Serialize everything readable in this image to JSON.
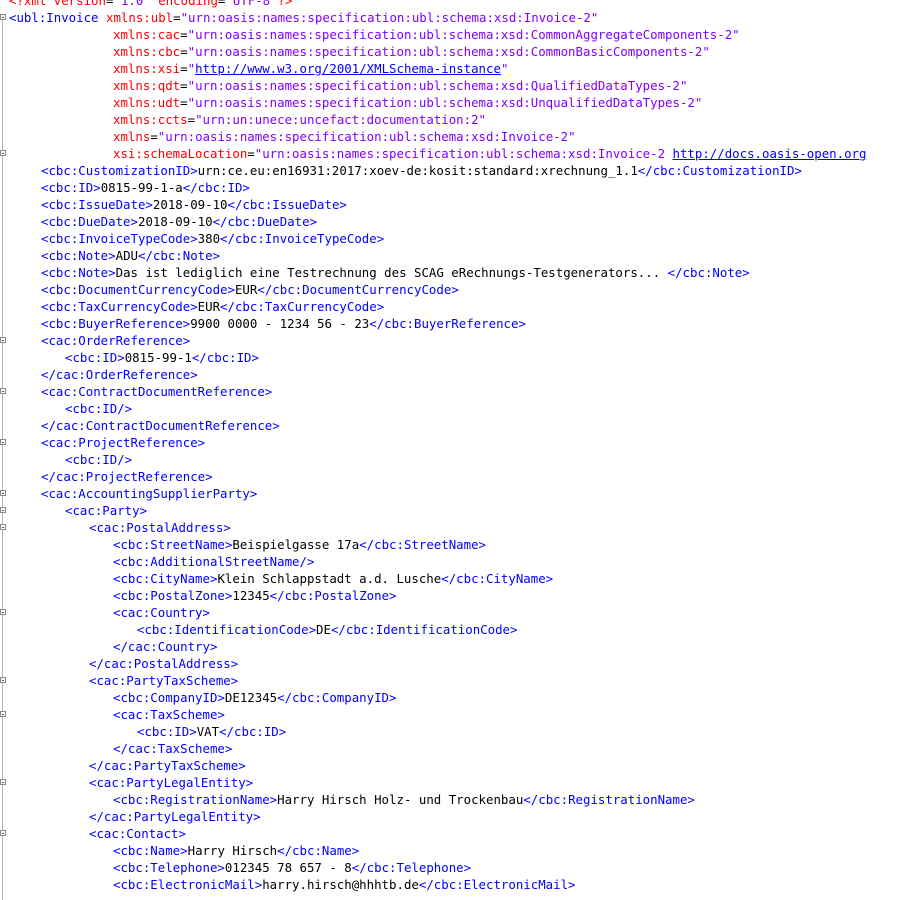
{
  "editor": {
    "colors": {
      "tag": "#0000ff",
      "attribute": "#ff0000",
      "value": "#8000ff",
      "text": "#000000"
    },
    "lines": [
      {
        "indent": 0,
        "tokens": [
          {
            "t": "pi",
            "v": "<?"
          },
          {
            "t": "attr",
            "v": "xml version"
          },
          {
            "t": "txt",
            "v": "="
          },
          {
            "t": "val",
            "v": "\"1.0\""
          },
          {
            "t": "attr",
            "v": " encoding"
          },
          {
            "t": "txt",
            "v": "="
          },
          {
            "t": "val",
            "v": "\"UTF-8\""
          },
          {
            "t": "pi",
            "v": "?>"
          }
        ]
      },
      {
        "indent": 0,
        "tokens": [
          {
            "t": "tag",
            "v": "<ubl:Invoice "
          },
          {
            "t": "attr",
            "v": "xmlns:ubl"
          },
          {
            "t": "txt",
            "v": "="
          },
          {
            "t": "val",
            "v": "\"urn:oasis:names:specification:ubl:schema:xsd:Invoice-2\""
          }
        ]
      },
      {
        "indent": 13,
        "tokens": [
          {
            "t": "attr",
            "v": "xmlns:cac"
          },
          {
            "t": "txt",
            "v": "="
          },
          {
            "t": "val",
            "v": "\"urn:oasis:names:specification:ubl:schema:xsd:CommonAggregateComponents-2\""
          }
        ]
      },
      {
        "indent": 13,
        "tokens": [
          {
            "t": "attr",
            "v": "xmlns:cbc"
          },
          {
            "t": "txt",
            "v": "="
          },
          {
            "t": "val",
            "v": "\"urn:oasis:names:specification:ubl:schema:xsd:CommonBasicComponents-2\""
          }
        ]
      },
      {
        "indent": 13,
        "tokens": [
          {
            "t": "attr",
            "v": "xmlns:xsi"
          },
          {
            "t": "txt",
            "v": "="
          },
          {
            "t": "val",
            "v": "\""
          },
          {
            "t": "link",
            "v": "http://www.w3.org/2001/XMLSchema-instance"
          },
          {
            "t": "val",
            "v": "\""
          }
        ]
      },
      {
        "indent": 13,
        "tokens": [
          {
            "t": "attr",
            "v": "xmlns:qdt"
          },
          {
            "t": "txt",
            "v": "="
          },
          {
            "t": "val",
            "v": "\"urn:oasis:names:specification:ubl:schema:xsd:QualifiedDataTypes-2\""
          }
        ]
      },
      {
        "indent": 13,
        "tokens": [
          {
            "t": "attr",
            "v": "xmlns:udt"
          },
          {
            "t": "txt",
            "v": "="
          },
          {
            "t": "val",
            "v": "\"urn:oasis:names:specification:ubl:schema:xsd:UnqualifiedDataTypes-2\""
          }
        ]
      },
      {
        "indent": 13,
        "tokens": [
          {
            "t": "attr",
            "v": "xmlns:ccts"
          },
          {
            "t": "txt",
            "v": "="
          },
          {
            "t": "val",
            "v": "\"urn:un:unece:uncefact:documentation:2\""
          }
        ]
      },
      {
        "indent": 13,
        "tokens": [
          {
            "t": "attr",
            "v": "xmlns"
          },
          {
            "t": "txt",
            "v": "="
          },
          {
            "t": "val",
            "v": "\"urn:oasis:names:specification:ubl:schema:xsd:Invoice-2\""
          }
        ]
      },
      {
        "indent": 13,
        "tokens": [
          {
            "t": "attr",
            "v": "xsi:schemaLocation"
          },
          {
            "t": "txt",
            "v": "="
          },
          {
            "t": "val",
            "v": "\"urn:oasis:names:specification:ubl:schema:xsd:Invoice-2 "
          },
          {
            "t": "link",
            "v": "http://docs.oasis-open.org"
          }
        ]
      },
      {
        "indent": 4,
        "tokens": [
          {
            "t": "tag",
            "v": "<cbc:CustomizationID>"
          },
          {
            "t": "txt",
            "v": "urn:ce.eu:en16931:2017:xoev-de:kosit:standard:xrechnung_1.1"
          },
          {
            "t": "tag",
            "v": "</cbc:CustomizationID>"
          }
        ]
      },
      {
        "indent": 4,
        "tokens": [
          {
            "t": "tag",
            "v": "<cbc:ID>"
          },
          {
            "t": "txt",
            "v": "0815-99-1-a"
          },
          {
            "t": "tag",
            "v": "</cbc:ID>"
          }
        ]
      },
      {
        "indent": 4,
        "tokens": [
          {
            "t": "tag",
            "v": "<cbc:IssueDate>"
          },
          {
            "t": "txt",
            "v": "2018-09-10"
          },
          {
            "t": "tag",
            "v": "</cbc:IssueDate>"
          }
        ]
      },
      {
        "indent": 4,
        "tokens": [
          {
            "t": "tag",
            "v": "<cbc:DueDate>"
          },
          {
            "t": "txt",
            "v": "2018-09-10"
          },
          {
            "t": "tag",
            "v": "</cbc:DueDate>"
          }
        ]
      },
      {
        "indent": 4,
        "tokens": [
          {
            "t": "tag",
            "v": "<cbc:InvoiceTypeCode>"
          },
          {
            "t": "txt",
            "v": "380"
          },
          {
            "t": "tag",
            "v": "</cbc:InvoiceTypeCode>"
          }
        ]
      },
      {
        "indent": 4,
        "tokens": [
          {
            "t": "tag",
            "v": "<cbc:Note>"
          },
          {
            "t": "txt",
            "v": "ADU"
          },
          {
            "t": "tag",
            "v": "</cbc:Note>"
          }
        ]
      },
      {
        "indent": 4,
        "tokens": [
          {
            "t": "tag",
            "v": "<cbc:Note>"
          },
          {
            "t": "txt",
            "v": "Das ist lediglich eine Testrechnung des SCAG eRechnungs-Testgenerators... "
          },
          {
            "t": "tag",
            "v": "</cbc:Note>"
          }
        ]
      },
      {
        "indent": 4,
        "tokens": [
          {
            "t": "tag",
            "v": "<cbc:DocumentCurrencyCode>"
          },
          {
            "t": "txt",
            "v": "EUR"
          },
          {
            "t": "tag",
            "v": "</cbc:DocumentCurrencyCode>"
          }
        ]
      },
      {
        "indent": 4,
        "tokens": [
          {
            "t": "tag",
            "v": "<cbc:TaxCurrencyCode>"
          },
          {
            "t": "txt",
            "v": "EUR"
          },
          {
            "t": "tag",
            "v": "</cbc:TaxCurrencyCode>"
          }
        ]
      },
      {
        "indent": 4,
        "tokens": [
          {
            "t": "tag",
            "v": "<cbc:BuyerReference>"
          },
          {
            "t": "txt",
            "v": "9900 0000 - 1234 56 - 23"
          },
          {
            "t": "tag",
            "v": "</cbc:BuyerReference>"
          }
        ]
      },
      {
        "indent": 4,
        "tokens": [
          {
            "t": "tag",
            "v": "<cac:OrderReference>"
          }
        ]
      },
      {
        "indent": 7,
        "tokens": [
          {
            "t": "tag",
            "v": "<cbc:ID>"
          },
          {
            "t": "txt",
            "v": "0815-99-1"
          },
          {
            "t": "tag",
            "v": "</cbc:ID>"
          }
        ]
      },
      {
        "indent": 4,
        "tokens": [
          {
            "t": "tag",
            "v": "</cac:OrderReference>"
          }
        ]
      },
      {
        "indent": 4,
        "tokens": [
          {
            "t": "tag",
            "v": "<cac:ContractDocumentReference>"
          }
        ]
      },
      {
        "indent": 7,
        "tokens": [
          {
            "t": "tag",
            "v": "<cbc:ID/>"
          }
        ]
      },
      {
        "indent": 4,
        "tokens": [
          {
            "t": "tag",
            "v": "</cac:ContractDocumentReference>"
          }
        ]
      },
      {
        "indent": 4,
        "tokens": [
          {
            "t": "tag",
            "v": "<cac:ProjectReference>"
          }
        ]
      },
      {
        "indent": 7,
        "tokens": [
          {
            "t": "tag",
            "v": "<cbc:ID/>"
          }
        ]
      },
      {
        "indent": 4,
        "tokens": [
          {
            "t": "tag",
            "v": "</cac:ProjectReference>"
          }
        ]
      },
      {
        "indent": 4,
        "tokens": [
          {
            "t": "tag",
            "v": "<cac:AccountingSupplierParty>"
          }
        ]
      },
      {
        "indent": 7,
        "tokens": [
          {
            "t": "tag",
            "v": "<cac:Party>"
          }
        ]
      },
      {
        "indent": 10,
        "tokens": [
          {
            "t": "tag",
            "v": "<cac:PostalAddress>"
          }
        ]
      },
      {
        "indent": 13,
        "tokens": [
          {
            "t": "tag",
            "v": "<cbc:StreetName>"
          },
          {
            "t": "txt",
            "v": "Beispielgasse 17a"
          },
          {
            "t": "tag",
            "v": "</cbc:StreetName>"
          }
        ]
      },
      {
        "indent": 13,
        "tokens": [
          {
            "t": "tag",
            "v": "<cbc:AdditionalStreetName/>"
          }
        ]
      },
      {
        "indent": 13,
        "tokens": [
          {
            "t": "tag",
            "v": "<cbc:CityName>"
          },
          {
            "t": "txt",
            "v": "Klein Schlappstadt a.d. Lusche"
          },
          {
            "t": "tag",
            "v": "</cbc:CityName>"
          }
        ]
      },
      {
        "indent": 13,
        "tokens": [
          {
            "t": "tag",
            "v": "<cbc:PostalZone>"
          },
          {
            "t": "txt",
            "v": "12345"
          },
          {
            "t": "tag",
            "v": "</cbc:PostalZone>"
          }
        ]
      },
      {
        "indent": 13,
        "tokens": [
          {
            "t": "tag",
            "v": "<cac:Country>"
          }
        ]
      },
      {
        "indent": 16,
        "tokens": [
          {
            "t": "tag",
            "v": "<cbc:IdentificationCode>"
          },
          {
            "t": "txt",
            "v": "DE"
          },
          {
            "t": "tag",
            "v": "</cbc:IdentificationCode>"
          }
        ]
      },
      {
        "indent": 13,
        "tokens": [
          {
            "t": "tag",
            "v": "</cac:Country>"
          }
        ]
      },
      {
        "indent": 10,
        "tokens": [
          {
            "t": "tag",
            "v": "</cac:PostalAddress>"
          }
        ]
      },
      {
        "indent": 10,
        "tokens": [
          {
            "t": "tag",
            "v": "<cac:PartyTaxScheme>"
          }
        ]
      },
      {
        "indent": 13,
        "tokens": [
          {
            "t": "tag",
            "v": "<cbc:CompanyID>"
          },
          {
            "t": "txt",
            "v": "DE12345"
          },
          {
            "t": "tag",
            "v": "</cbc:CompanyID>"
          }
        ]
      },
      {
        "indent": 13,
        "tokens": [
          {
            "t": "tag",
            "v": "<cac:TaxScheme>"
          }
        ]
      },
      {
        "indent": 16,
        "tokens": [
          {
            "t": "tag",
            "v": "<cbc:ID>"
          },
          {
            "t": "txt",
            "v": "VAT"
          },
          {
            "t": "tag",
            "v": "</cbc:ID>"
          }
        ]
      },
      {
        "indent": 13,
        "tokens": [
          {
            "t": "tag",
            "v": "</cac:TaxScheme>"
          }
        ]
      },
      {
        "indent": 10,
        "tokens": [
          {
            "t": "tag",
            "v": "</cac:PartyTaxScheme>"
          }
        ]
      },
      {
        "indent": 10,
        "tokens": [
          {
            "t": "tag",
            "v": "<cac:PartyLegalEntity>"
          }
        ]
      },
      {
        "indent": 13,
        "tokens": [
          {
            "t": "tag",
            "v": "<cbc:RegistrationName>"
          },
          {
            "t": "txt",
            "v": "Harry Hirsch Holz- und Trockenbau"
          },
          {
            "t": "tag",
            "v": "</cbc:RegistrationName>"
          }
        ]
      },
      {
        "indent": 10,
        "tokens": [
          {
            "t": "tag",
            "v": "</cac:PartyLegalEntity>"
          }
        ]
      },
      {
        "indent": 10,
        "tokens": [
          {
            "t": "tag",
            "v": "<cac:Contact>"
          }
        ]
      },
      {
        "indent": 13,
        "tokens": [
          {
            "t": "tag",
            "v": "<cbc:Name>"
          },
          {
            "t": "txt",
            "v": "Harry Hirsch"
          },
          {
            "t": "tag",
            "v": "</cbc:Name>"
          }
        ]
      },
      {
        "indent": 13,
        "tokens": [
          {
            "t": "tag",
            "v": "<cbc:Telephone>"
          },
          {
            "t": "txt",
            "v": "012345 78 657 - 8"
          },
          {
            "t": "tag",
            "v": "</cbc:Telephone>"
          }
        ]
      },
      {
        "indent": 13,
        "tokens": [
          {
            "t": "tag",
            "v": "<cbc:ElectronicMail>"
          },
          {
            "t": "txt",
            "v": "harry.hirsch@hhhtb.de"
          },
          {
            "t": "tag",
            "v": "</cbc:ElectronicMail>"
          }
        ]
      }
    ]
  }
}
